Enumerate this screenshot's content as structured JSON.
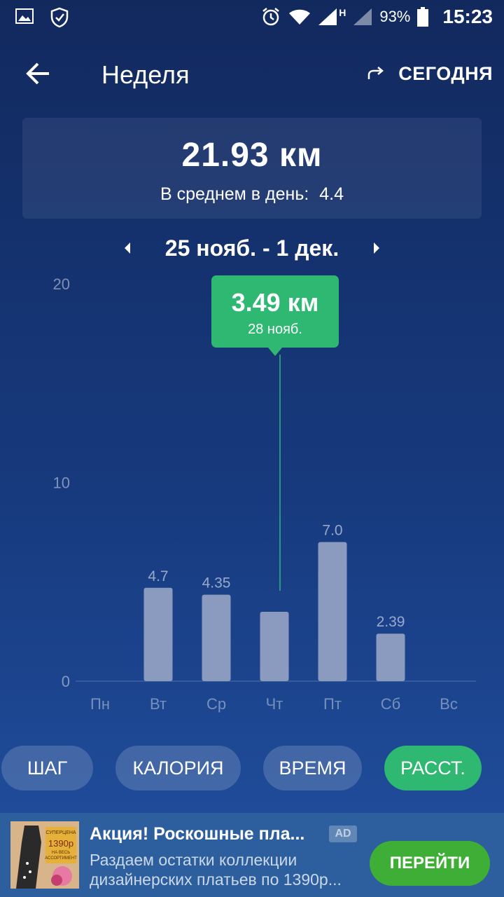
{
  "status_bar": {
    "battery_percent": "93%",
    "time": "15:23",
    "network_label": "H"
  },
  "header": {
    "title": "Неделя",
    "today_label": "СЕГОДНЯ"
  },
  "summary": {
    "total": "21.93 км",
    "average_label": "В среднем в день:",
    "average_value": "4.4"
  },
  "range": {
    "label": "25 нояб. - 1 дек."
  },
  "tooltip": {
    "value": "3.49 км",
    "date": "28 нояб."
  },
  "chart_data": {
    "type": "bar",
    "categories": [
      "Пн",
      "Вт",
      "Ср",
      "Чт",
      "Пт",
      "Сб",
      "Вс"
    ],
    "values": [
      0,
      4.7,
      4.35,
      3.49,
      7.0,
      2.39,
      0
    ],
    "data_labels": [
      "",
      "4.7",
      "4.35",
      "",
      "7.0",
      "2.39",
      ""
    ],
    "yticks": [
      "0",
      "10",
      "20"
    ],
    "ylim": [
      0,
      20
    ],
    "selected_index": 3,
    "colors": {
      "bar": "#8a9bbf",
      "highlight": "#2eb872"
    }
  },
  "tabs": [
    {
      "label": "ШАГ",
      "active": false
    },
    {
      "label": "КАЛОРИЯ",
      "active": false
    },
    {
      "label": "ВРЕМЯ",
      "active": false
    },
    {
      "label": "РАССТ.",
      "active": true
    }
  ],
  "ad": {
    "title": "Акция! Роскошные пла...",
    "badge": "AD",
    "line1": "Раздаем остатки коллекции",
    "line2": "дизайнерских платьев по 1390р...",
    "button": "ПЕРЕЙТИ",
    "image_text": [
      "СУПЕРЦЕНА",
      "1390р",
      "НА ВЕСЬ",
      "АССОРТИМЕНТ"
    ]
  }
}
